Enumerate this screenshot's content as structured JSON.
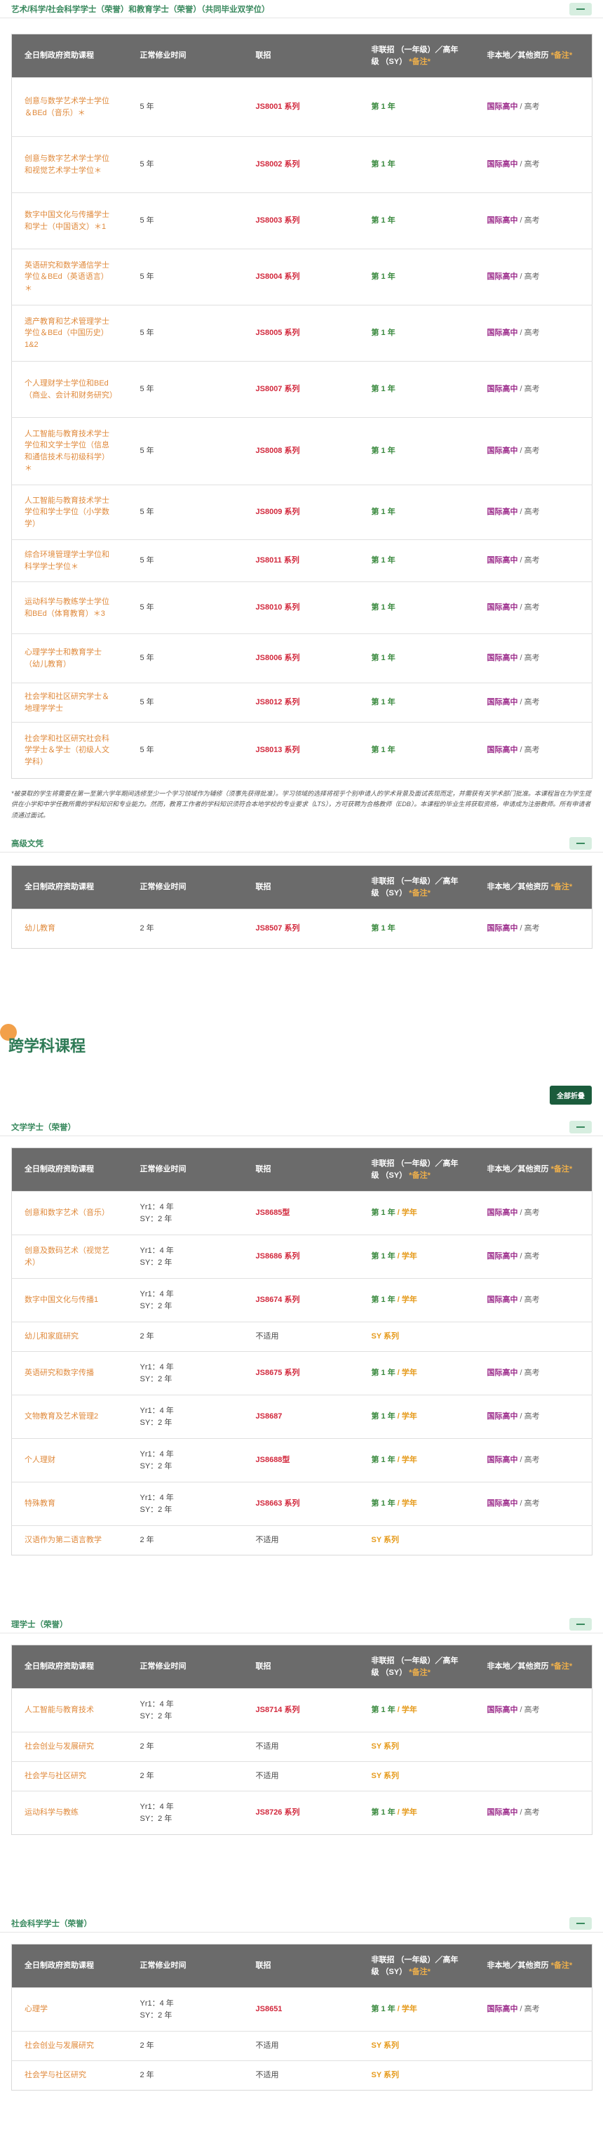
{
  "headers": [
    "全日制政府资助课程",
    "正常修业时间",
    "联招",
    "非联招 （一年级）／高年级 （SY）",
    "非本地／其他资历"
  ],
  "header_mark": "*备注*",
  "intl_text": "国际高中",
  "hk_text": "高考",
  "sections": {
    "s1": {
      "title": "艺术/科学/社会科学学士（荣誉）和教育学士（荣誉）（共同毕业双学位）",
      "rows": [
        {
          "name": "创意与数学艺术学士学位＆BEd（音乐）＊",
          "dur": "5 年",
          "jup": "JS8001 系列",
          "non": "第 1 年"
        },
        {
          "name": "创意与数字艺术学士学位和视觉艺术学士学位＊",
          "dur": "5 年",
          "jup": "JS8002 系列",
          "non": "第 1 年"
        },
        {
          "name": "数字中国文化与传播学士和学士（中国语文）＊1",
          "dur": "5 年",
          "jup": "JS8003 系列",
          "non": "第 1 年"
        },
        {
          "name": "英语研究和数学通信学士学位＆BEd（英语语言）＊",
          "dur": "5 年",
          "jup": "JS8004 系列",
          "non": "第 1 年"
        },
        {
          "name": "遗产教育和艺术管理学士学位＆BEd（中国历史）1&2",
          "dur": "5 年",
          "jup": "JS8005 系列",
          "non": "第 1 年"
        },
        {
          "name": "个人理财学士学位和BEd（商业、会计和财务研究）",
          "dur": "5 年",
          "jup": "JS8007 系列",
          "non": "第 1 年"
        },
        {
          "name": "人工智能与教育技术学士学位和文学士学位（信息和通信技术与初级科学）＊",
          "dur": "5 年",
          "jup": "JS8008 系列",
          "non": "第 1 年"
        },
        {
          "name": "人工智能与教育技术学士学位和学士学位（小学数学）",
          "dur": "5 年",
          "jup": "JS8009 系列",
          "non": "第 1 年"
        },
        {
          "name": "综合环境管理学士学位和科学学士学位＊",
          "dur": "5 年",
          "jup": "JS8011 系列",
          "non": "第 1 年"
        },
        {
          "name": "运动科学与教练学士学位和BEd（体育教育）＊3",
          "dur": "5 年",
          "jup": "JS8010 系列",
          "non": "第 1 年"
        },
        {
          "name": "心理学学士和教育学士（幼儿教育）",
          "dur": "5 年",
          "jup": "JS8006 系列",
          "non": "第 1 年"
        },
        {
          "name": "社会学和社区研究学士＆地理学学士",
          "dur": "5 年",
          "jup": "JS8012 系列",
          "non": "第 1 年"
        },
        {
          "name": "社会学和社区研究社会科学学士＆学士（初级人文学科）",
          "dur": "5 年",
          "jup": "JS8013 系列",
          "non": "第 1 年"
        }
      ],
      "note": "*被录取的学生将需要在第一至第六学年期间选修至少一个学习领域作为辅修（须事先获得批准）。学习领域的选择将视乎个别申请人的学术背景及面试表现而定，并需获有关学术部门批准。本课程旨在为学生提供在小学和中学任教所需的学科知识和专业能力。然而，教育工作者的学科知识须符合本地学校的专业要求（LTS），方可获聘为合格教师（EDB）。本课程的毕业生将获取资格，申请成为注册教师。所有申请者须通过面试。"
    },
    "s2": {
      "title": "高级文凭",
      "rows": [
        {
          "name": "幼儿教育",
          "dur": "2 年",
          "jup": "JS8507 系列",
          "non": "第 1 年"
        }
      ]
    },
    "big_title": "跨学科课程",
    "expand_all": "全部折叠",
    "s3": {
      "title": "文学学士（荣誉）",
      "rows": [
        {
          "name": "创意和数字艺术（音乐）",
          "dur1": "Yr1：4 年",
          "dur2": "SY：2 年",
          "jup": "JS8685型",
          "non": "第 1 年",
          "non2": "学年",
          "other": true
        },
        {
          "name": "创意及数码艺术（视觉艺术）",
          "dur1": "Yr1：4 年",
          "dur2": "SY：2 年",
          "jup": "JS8686 系列",
          "non": "第 1 年",
          "non2": "学年",
          "other": true
        },
        {
          "name": "数字中国文化与传播1",
          "dur1": "Yr1：4 年",
          "dur2": "SY：2 年",
          "jup": "JS8674 系列",
          "non": "第 1 年",
          "non2": "学年",
          "other": true
        },
        {
          "name": "幼儿和家庭研究",
          "dur1": "2 年",
          "dur2": "",
          "jup": "不适用",
          "non": "",
          "non2": "SY 系列",
          "other": false,
          "na": true
        },
        {
          "name": "英语研究和数字传播",
          "dur1": "Yr1：4 年",
          "dur2": "SY：2 年",
          "jup": "JS8675 系列",
          "non": "第 1 年",
          "non2": "学年",
          "other": true
        },
        {
          "name": "文物教育及艺术管理2",
          "dur1": "Yr1：4 年",
          "dur2": "SY：2 年",
          "jup": "JS8687",
          "non": "第 1 年",
          "non2": "学年",
          "other": true
        },
        {
          "name": "个人理财",
          "dur1": "Yr1：4 年",
          "dur2": "SY：2 年",
          "jup": "JS8688型",
          "non": "第 1 年",
          "non2": "学年",
          "other": true
        },
        {
          "name": "特殊教育",
          "dur1": "Yr1：4 年",
          "dur2": "SY：2 年",
          "jup": "JS8663 系列",
          "non": "第 1 年",
          "non2": "学年",
          "other": true
        },
        {
          "name": "汉语作为第二语言教学",
          "dur1": "2 年",
          "dur2": "",
          "jup": "不适用",
          "non": "",
          "non2": "SY 系列",
          "other": false,
          "na": true
        }
      ]
    },
    "s4": {
      "title": "理学士（荣誉）",
      "rows": [
        {
          "name": "人工智能与教育技术",
          "dur1": "Yr1：4 年",
          "dur2": "SY：2 年",
          "jup": "JS8714 系列",
          "non": "第 1 年",
          "non2": "学年",
          "other": true
        },
        {
          "name": "社会创业与发展研究",
          "dur1": "2 年",
          "dur2": "",
          "jup": "不适用",
          "non": "",
          "non2": "SY 系列",
          "other": false,
          "na": true
        },
        {
          "name": "社会学与社区研究",
          "dur1": "2 年",
          "dur2": "",
          "jup": "不适用",
          "non": "",
          "non2": "SY 系列",
          "other": false,
          "na": true
        },
        {
          "name": "运动科学与教练",
          "dur1": "Yr1：4 年",
          "dur2": "SY：2 年",
          "jup": "JS8726 系列",
          "non": "第 1 年",
          "non2": "学年",
          "other": true
        }
      ]
    },
    "s5": {
      "title": "社会科学学士（荣誉）",
      "rows": [
        {
          "name": "心理学",
          "dur1": "Yr1：4 年",
          "dur2": "SY：2 年",
          "jup": "JS8651",
          "non": "第 1 年",
          "non2": "学年",
          "other": true
        },
        {
          "name": "社会创业与发展研究",
          "dur1": "2 年",
          "dur2": "",
          "jup": "不适用",
          "non": "",
          "non2": "SY 系列",
          "other": false,
          "na": true
        },
        {
          "name": "社会学与社区研究",
          "dur1": "2 年",
          "dur2": "",
          "jup": "不适用",
          "non": "",
          "non2": "SY 系列",
          "other": false,
          "na": true
        }
      ]
    }
  }
}
